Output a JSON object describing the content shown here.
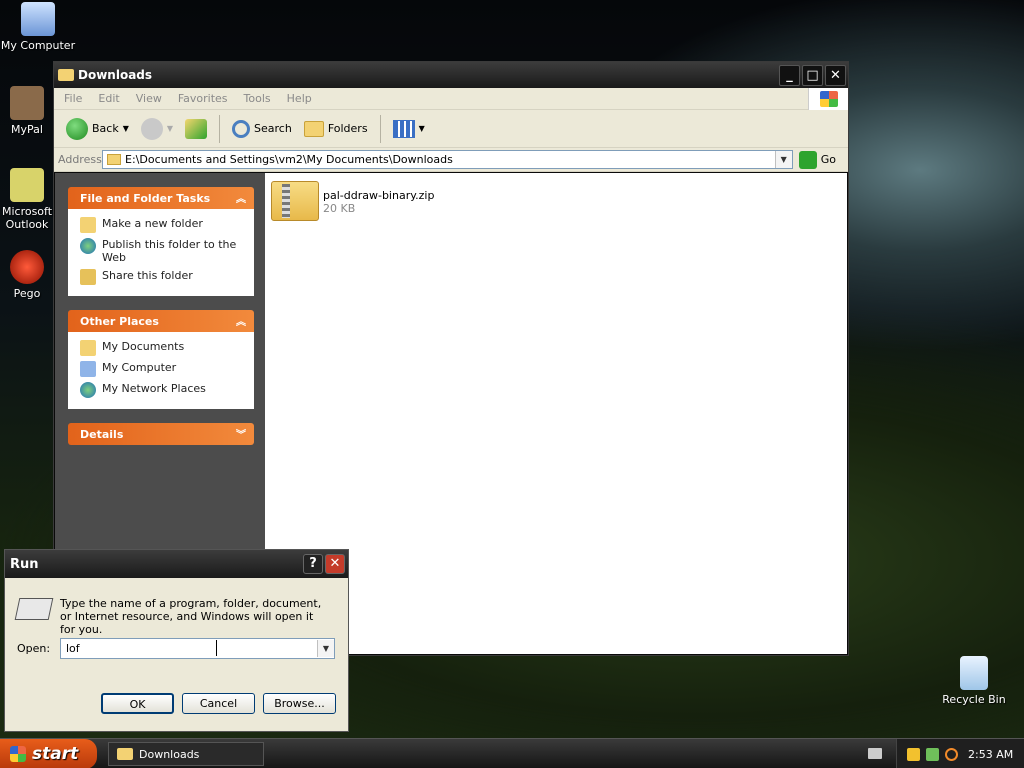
{
  "desktop": {
    "icons": [
      {
        "label": "My Computer"
      },
      {
        "label": "MyPal"
      },
      {
        "label": "Microsoft Outlook"
      },
      {
        "label": "Pego"
      },
      {
        "label": "Recycle Bin"
      }
    ]
  },
  "explorer": {
    "title": "Downloads",
    "menu": [
      "File",
      "Edit",
      "View",
      "Favorites",
      "Tools",
      "Help"
    ],
    "toolbar": {
      "back_label": "Back",
      "search_label": "Search",
      "folders_label": "Folders"
    },
    "address": {
      "label": "Address",
      "value": "E:\\Documents and Settings\\vm2\\My Documents\\Downloads",
      "go_label": "Go"
    },
    "file_tasks": {
      "title": "File and Folder Tasks",
      "items": [
        "Make a new folder",
        "Publish this folder to the Web",
        "Share this folder"
      ]
    },
    "other_places": {
      "title": "Other Places",
      "items": [
        "My Documents",
        "My Computer",
        "My Network Places"
      ]
    },
    "details": {
      "title": "Details"
    },
    "files": [
      {
        "name": "pal-ddraw-binary.zip",
        "size": "20 KB"
      }
    ]
  },
  "run_dialog": {
    "title": "Run",
    "description": "Type the name of a program, folder, document, or Internet resource, and Windows will open it for you.",
    "open_label": "Open:",
    "open_value": "lof",
    "ok_label": "OK",
    "cancel_label": "Cancel",
    "browse_label": "Browse..."
  },
  "taskbar": {
    "start_label": "start",
    "tasks": [
      {
        "label": "Downloads"
      }
    ],
    "clock": "2:53 AM"
  }
}
